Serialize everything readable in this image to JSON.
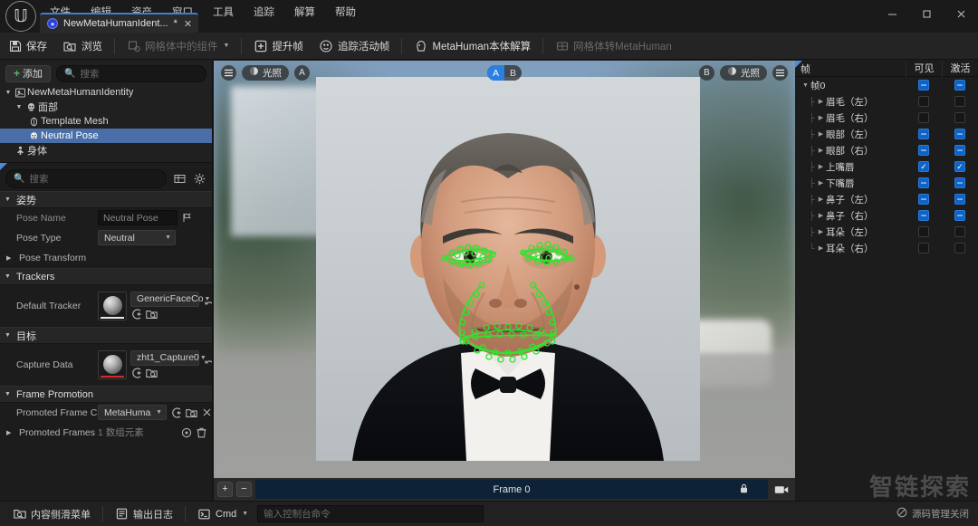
{
  "window": {
    "app_logo": "unreal-engine-logo",
    "menus": [
      "文件",
      "编辑",
      "资产",
      "窗口",
      "工具",
      "追踪",
      "解算",
      "帮助"
    ],
    "controls": {
      "minimize": "—",
      "maximize": "❐",
      "close": "✕"
    }
  },
  "tab": {
    "label": "NewMetaHumanIdent...",
    "dirty": "*",
    "close": "✕"
  },
  "toolbar": {
    "items": [
      {
        "label": "保存",
        "icon": "save-icon",
        "disabled": false
      },
      {
        "label": "浏览",
        "icon": "browse-icon",
        "disabled": false
      },
      {
        "label": "网格体中的组件",
        "icon": "components-icon",
        "disabled": true,
        "caret": "▼"
      },
      {
        "label": "提升帧",
        "icon": "promote-frame-icon",
        "disabled": false
      },
      {
        "label": "追踪活动帧",
        "icon": "track-active-frame-icon",
        "disabled": false
      },
      {
        "label": "MetaHuman本体解算",
        "icon": "metahuman-solve-icon",
        "disabled": false
      },
      {
        "label": "网格体转MetaHuman",
        "icon": "mesh-to-metahuman-icon",
        "disabled": true
      }
    ]
  },
  "outliner": {
    "add_button": "添加",
    "add_plus": "+",
    "search_placeholder": "搜索",
    "tree": [
      {
        "label": "NewMetaHumanIdentity",
        "depth": 0,
        "expanded": true,
        "icon": "identity-icon",
        "selected": false
      },
      {
        "label": "面部",
        "depth": 1,
        "expanded": true,
        "icon": "skull-icon",
        "selected": false
      },
      {
        "label": "Template Mesh",
        "depth": 2,
        "expanded": false,
        "icon": "mesh-icon",
        "selected": false
      },
      {
        "label": "Neutral Pose",
        "depth": 2,
        "expanded": false,
        "icon": "pose-icon",
        "selected": true
      },
      {
        "label": "身体",
        "depth": 1,
        "expanded": false,
        "icon": "body-icon",
        "selected": false
      }
    ]
  },
  "details": {
    "search_placeholder": "搜索",
    "grid_icon": "grid-view-icon",
    "settings_icon": "gear-icon",
    "sections": [
      {
        "title": "姿势",
        "rows": [
          {
            "label": "Pose Name",
            "type": "text",
            "value": "Neutral Pose",
            "dim": true,
            "trailing_icon": "flag-icon"
          },
          {
            "label": "Pose Type",
            "type": "combo",
            "value": "Neutral"
          },
          {
            "label": "Pose Transform",
            "type": "expand",
            "value": ""
          }
        ]
      },
      {
        "title": "Trackers",
        "rows": [
          {
            "label": "Default Tracker",
            "type": "asset",
            "value": "GenericFaceCo",
            "underline": "white",
            "reset_icon": "reset-arrow-icon"
          }
        ]
      },
      {
        "title": "目标",
        "rows": [
          {
            "label": "Capture Data",
            "type": "asset",
            "value": "zht1_Capture0",
            "underline": "red",
            "reset_icon": "reset-arrow-icon"
          }
        ]
      },
      {
        "title": "Frame Promotion",
        "rows": [
          {
            "label": "Promoted Frame Class",
            "type": "combo-actions",
            "value": "MetaHuma"
          },
          {
            "label": "Promoted Frames",
            "type": "array",
            "value": "1 数组元素"
          }
        ]
      }
    ]
  },
  "viewport": {
    "left_toolbar": {
      "menu_icon": "hamburger-icon",
      "lighting_label": "光照",
      "lighting_icon": "lighting-icon",
      "view_label": "A"
    },
    "right_toolbar": {
      "view_label": "B",
      "lighting_label": "光照",
      "lighting_icon": "lighting-icon",
      "menu_icon": "hamburger-icon"
    },
    "ab_toggle": {
      "options": [
        "A",
        "B"
      ],
      "selected": "A"
    },
    "bottom": {
      "zoom_in": "+",
      "zoom_out": "−",
      "frame_label": "Frame 0",
      "lock_icon": "lock-icon",
      "camera_icon": "camera-icon"
    },
    "tracking_color": "#2ee52e"
  },
  "frames_panel": {
    "columns": {
      "name": "帧",
      "visible": "可见",
      "active": "激活"
    },
    "rows": [
      {
        "label": "帧0",
        "depth": 0,
        "expanded": true,
        "visible": "partial",
        "active": "partial"
      },
      {
        "label": "眉毛（左）",
        "depth": 1,
        "expanded": false,
        "visible": "off",
        "active": "off"
      },
      {
        "label": "眉毛（右）",
        "depth": 1,
        "expanded": false,
        "visible": "off",
        "active": "off"
      },
      {
        "label": "眼部（左）",
        "depth": 1,
        "expanded": false,
        "visible": "partial",
        "active": "partial"
      },
      {
        "label": "眼部（右）",
        "depth": 1,
        "expanded": false,
        "visible": "partial",
        "active": "partial"
      },
      {
        "label": "上嘴唇",
        "depth": 1,
        "expanded": false,
        "visible": "on",
        "active": "on"
      },
      {
        "label": "下嘴唇",
        "depth": 1,
        "expanded": false,
        "visible": "partial",
        "active": "partial"
      },
      {
        "label": "鼻子（左）",
        "depth": 1,
        "expanded": false,
        "visible": "partial",
        "active": "partial"
      },
      {
        "label": "鼻子（右）",
        "depth": 1,
        "expanded": false,
        "visible": "partial",
        "active": "partial"
      },
      {
        "label": "耳朵（左）",
        "depth": 1,
        "expanded": false,
        "visible": "off",
        "active": "off"
      },
      {
        "label": "耳朵（右）",
        "depth": 1,
        "expanded": false,
        "visible": "off",
        "active": "off"
      }
    ]
  },
  "statusbar": {
    "content_drawer": "内容侧滑菜单",
    "output_log": "输出日志",
    "cmd_label": "Cmd",
    "cmd_placeholder": "输入控制台命令",
    "source_control": "源码管理关闭",
    "source_control_icon": "no-entry-icon"
  },
  "watermark": "智链探索",
  "colors": {
    "accent_blue": "#2b7fe0",
    "selection_blue": "#4a6ea8",
    "tracking_green": "#2ee52e",
    "red_underline": "#d12d2d",
    "panel_bg": "#1c1c1c"
  }
}
